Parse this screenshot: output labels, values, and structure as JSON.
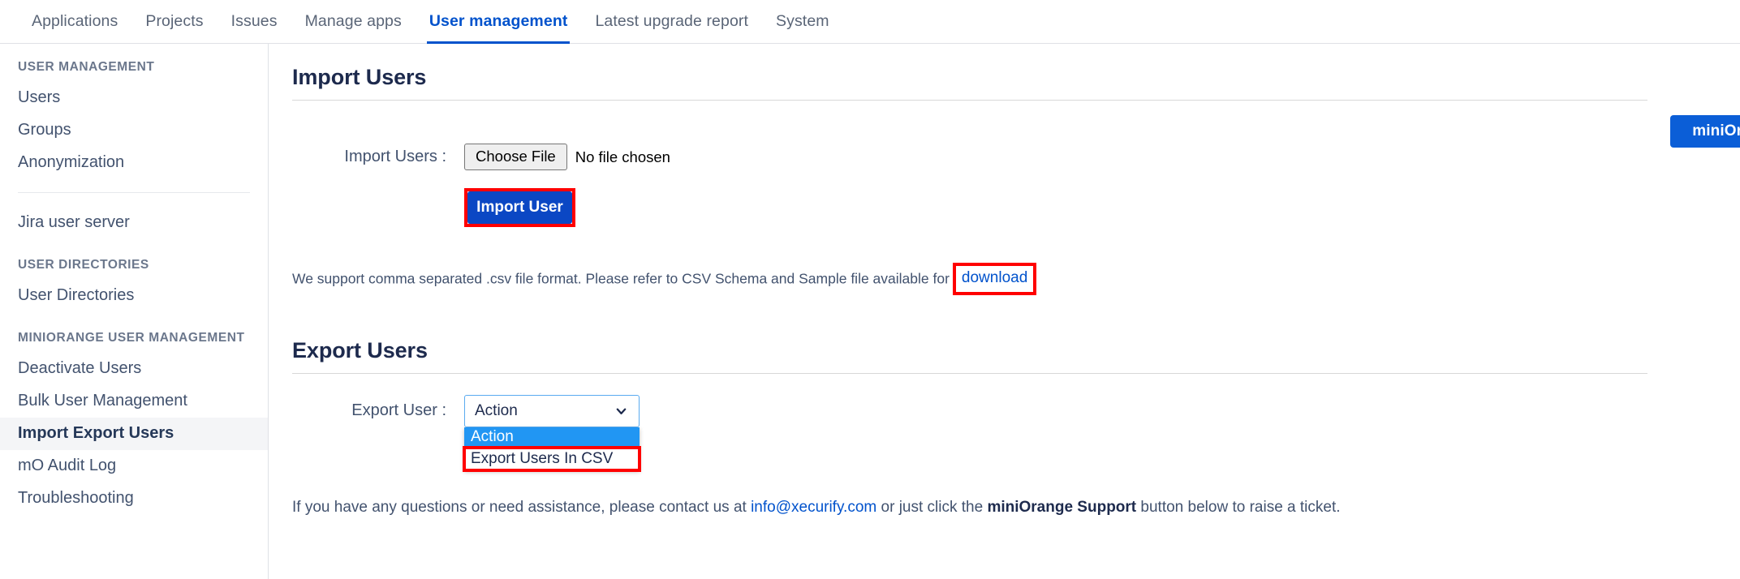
{
  "topnav": {
    "items": [
      {
        "label": "Applications",
        "active": false
      },
      {
        "label": "Projects",
        "active": false
      },
      {
        "label": "Issues",
        "active": false
      },
      {
        "label": "Manage apps",
        "active": false
      },
      {
        "label": "User management",
        "active": true
      },
      {
        "label": "Latest upgrade report",
        "active": false
      },
      {
        "label": "System",
        "active": false
      }
    ]
  },
  "sidebar": {
    "group1_title": "USER MANAGEMENT",
    "group1_items": [
      {
        "label": "Users"
      },
      {
        "label": "Groups"
      },
      {
        "label": "Anonymization"
      }
    ],
    "standalone": {
      "label": "Jira user server"
    },
    "group2_title": "USER DIRECTORIES",
    "group2_items": [
      {
        "label": "User Directories"
      }
    ],
    "group3_title": "MINIORANGE USER MANAGEMENT",
    "group3_items": [
      {
        "label": "Deactivate Users",
        "selected": false
      },
      {
        "label": "Bulk User Management",
        "selected": false
      },
      {
        "label": "Import Export Users",
        "selected": true
      },
      {
        "label": "mO Audit Log",
        "selected": false
      },
      {
        "label": "Troubleshooting",
        "selected": false
      }
    ]
  },
  "main": {
    "import_section": {
      "title": "Import Users",
      "field_label": "Import Users :",
      "choose_file_label": "Choose File",
      "file_status": "No file chosen",
      "submit_label": "Import User",
      "helper_text": "We support comma separated .csv file format. Please refer to CSV Schema and Sample file available for",
      "download_label": "download"
    },
    "export_section": {
      "title": "Export Users",
      "field_label": "Export User :",
      "selected_value": "Action",
      "options": [
        {
          "label": "Action",
          "state": "highlighted"
        },
        {
          "label": "Export Users In CSV",
          "state": "outlined"
        }
      ]
    },
    "footer": {
      "text_before": "If you have any questions or need assistance, please contact us at",
      "email": "info@xecurify.com",
      "text_middle": "or just click the",
      "bold_term": "miniOrange Support",
      "text_after": "button below to raise a ticket."
    },
    "support_button": "miniOrange Support"
  },
  "colors": {
    "accent_blue": "#0052cc",
    "button_blue": "#0b5ed7",
    "import_blue": "#0b47c4",
    "highlight_red": "#ff0000",
    "option_highlight": "#2196f3"
  }
}
